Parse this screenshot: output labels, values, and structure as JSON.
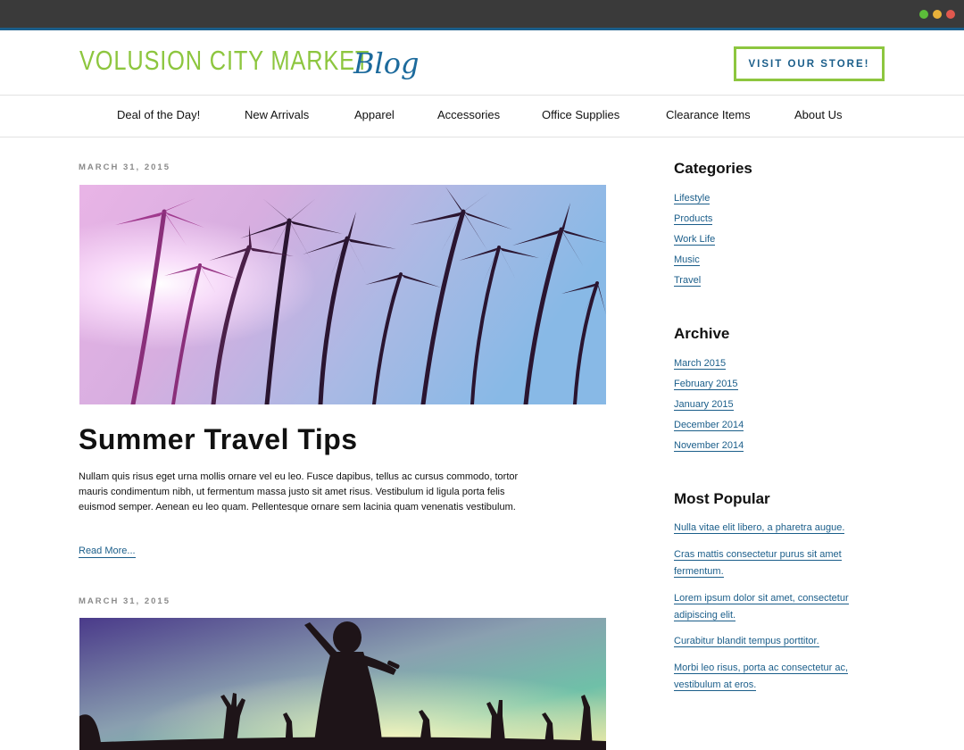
{
  "header": {
    "logo_main": "VOLUSION CITY MARKET",
    "logo_blog": "Blog",
    "store_button": "VISIT OUR STORE!"
  },
  "nav": {
    "items": [
      "Deal of the Day!",
      "New Arrivals",
      "Apparel",
      "Accessories",
      "Office Supplies",
      "Clearance Items",
      "About Us"
    ]
  },
  "posts": [
    {
      "date": "MARCH 31, 2015",
      "title": "Summer Travel Tips",
      "excerpt": "Nullam quis risus eget urna mollis ornare vel eu leo. Fusce dapibus, tellus ac cursus commodo, tortor mauris condimentum nibh, ut fermentum massa justo sit amet risus. Vestibulum id ligula porta felis euismod semper. Aenean eu leo quam. Pellentesque ornare sem lacinia quam venenatis vestibulum.",
      "read_more": "Read More..."
    },
    {
      "date": "MARCH 31, 2015"
    }
  ],
  "sidebar": {
    "categories": {
      "title": "Categories",
      "links": [
        "Lifestyle",
        "Products",
        "Work Life",
        "Music",
        "Travel"
      ]
    },
    "archive": {
      "title": "Archive",
      "links": [
        "March 2015",
        "February 2015",
        "January 2015",
        "December 2014",
        "November 2014"
      ]
    },
    "popular": {
      "title": "Most Popular",
      "links": [
        "Nulla vitae elit libero, a pharetra augue.",
        "Cras mattis consectetur purus sit amet fermentum.",
        "Lorem ipsum dolor sit amet, consectetur adipiscing elit.",
        "Curabitur blandit tempus porttitor.",
        "Morbi leo risus, porta ac consectetur ac, vestibulum at eros."
      ]
    }
  },
  "colors": {
    "brand_green": "#8dc63f",
    "brand_blue": "#1b5e8a",
    "chrome_bg": "#3a3a3a"
  }
}
